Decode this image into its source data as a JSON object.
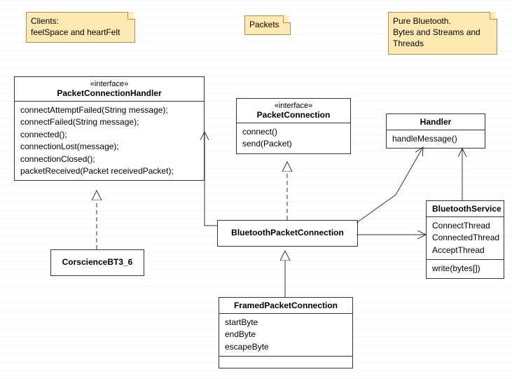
{
  "notes": {
    "clients": "Clients:\nfeelSpace and heartFelt",
    "packets": "Packets",
    "bluetooth": "Pure Bluetooth.\nBytes and Streams and\nThreads"
  },
  "classes": {
    "pch": {
      "stereotype": "«interface»",
      "name": "PacketConnectionHandler",
      "methods": [
        "connectAttemptFailed(String message);",
        "connectFailed(String message);",
        "connected();",
        "connectionLost(message);",
        "connectionClosed();",
        "packetReceived(Packet receivedPacket);"
      ]
    },
    "pc": {
      "stereotype": "«interface»",
      "name": "PacketConnection",
      "methods": [
        "connect()",
        "send(Packet)"
      ]
    },
    "handler": {
      "name": "Handler",
      "methods": [
        "handleMessage()"
      ]
    },
    "btservice": {
      "name": "BluetoothService",
      "attributes": [
        "ConnectThread",
        "ConnectedThread",
        "AcceptThread"
      ],
      "methods": [
        "write(bytes[])"
      ]
    },
    "bpc": {
      "name": "BluetoothPacketConnection"
    },
    "fpc": {
      "name": "FramedPacketConnection",
      "attributes": [
        "startByte",
        "endByte",
        "escapeByte"
      ]
    },
    "cor": {
      "name": "CorscienceBT3_6"
    }
  }
}
